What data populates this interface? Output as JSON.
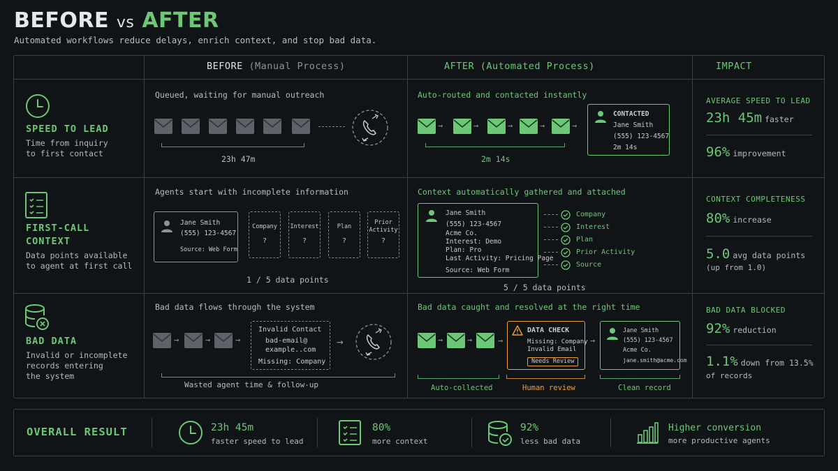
{
  "header": {
    "title_before": "BEFORE",
    "title_vs": "vs",
    "title_after": "AFTER",
    "subtitle": "Automated workflows reduce delays, enrich context, and stop bad data."
  },
  "columns": {
    "before": "BEFORE",
    "before_sub": "(Manual Process)",
    "after": "AFTER",
    "after_sub": "(Automated Process)",
    "impact": "IMPACT"
  },
  "rows": {
    "speed": {
      "title": "SPEED TO LEAD",
      "desc": "Time from inquiry\nto first contact",
      "before_caption": "Queued, waiting for manual outreach",
      "before_time": "23h 47m",
      "after_caption": "Auto-routed and contacted instantly",
      "after_time": "2m 14s",
      "card": {
        "status": "CONTACTED",
        "name": "Jane Smith",
        "phone": "(555) 123-4567",
        "time": "2m 14s"
      },
      "impact_label": "AVERAGE SPEED TO LEAD",
      "impact_1_value": "23h 45m",
      "impact_1_text": "faster",
      "impact_2_value": "96%",
      "impact_2_text": "improvement"
    },
    "context": {
      "title_1": "FIRST-CALL",
      "title_2": "CONTEXT",
      "desc": "Data points available\nto agent at first call",
      "before_caption": "Agents start with incomplete information",
      "before_card": {
        "name": "Jane Smith",
        "phone": "(555) 123-4567",
        "source": "Source: Web Form"
      },
      "missing": [
        {
          "label": "Company",
          "value": "?"
        },
        {
          "label": "Interest",
          "value": "?"
        },
        {
          "label": "Plan",
          "value": "?"
        },
        {
          "label": "Prior\nActivity",
          "value": "?"
        }
      ],
      "before_count": "1 / 5 data points",
      "after_caption": "Context automatically gathered and attached",
      "after_card": {
        "name": "Jane Smith",
        "phone": "(555) 123-4567",
        "company": "Acme Co.",
        "interest": "Interest: Demo",
        "plan": "Plan: Pro",
        "activity": "Last Activity: Pricing Page",
        "source": "Source: Web Form"
      },
      "checks": [
        "Company",
        "Interest",
        "Plan",
        "Prior Activity",
        "Source"
      ],
      "after_count": "5 / 5 data points",
      "impact_label": "CONTEXT COMPLETENESS",
      "impact_1_value": "80%",
      "impact_1_text": "increase",
      "impact_2_value": "5.0",
      "impact_2_text": "avg data points",
      "impact_2_sub": "(up from 1.0)"
    },
    "bad": {
      "title": "BAD DATA",
      "desc": "Invalid or incomplete\nrecords entering\nthe system",
      "before_caption": "Bad data flows through the system",
      "invalid": {
        "title": "Invalid Contact",
        "email_1": "bad-email@",
        "email_2": "example..com",
        "missing": "Missing: Company"
      },
      "before_footer": "Wasted agent time & follow-up",
      "after_caption": "Bad data caught and resolved at the right time",
      "check": {
        "title": "DATA CHECK",
        "line_1": "Missing: Company",
        "line_2": "Invalid Email",
        "badge": "Needs Review"
      },
      "clean": {
        "name": "Jane Smith",
        "phone": "(555) 123-4567",
        "company": "Acme Co.",
        "email": "jane.smith@acme.com"
      },
      "stage_1": "Auto-collected",
      "stage_2": "Human review",
      "stage_3": "Clean record",
      "impact_label": "BAD DATA BLOCKED",
      "impact_1_value": "92%",
      "impact_1_text": "reduction",
      "impact_2_value": "1.1%",
      "impact_2_text": "down from 13.5%",
      "impact_2_sub": "of records"
    }
  },
  "overall": {
    "label": "OVERALL RESULT",
    "items": [
      {
        "value": "23h 45m",
        "label": "faster speed to lead",
        "icon": "clock-icon"
      },
      {
        "value": "80%",
        "label": "more context",
        "icon": "checklist-icon"
      },
      {
        "value": "92%",
        "label": "less bad data",
        "icon": "database-check-icon"
      },
      {
        "value": "Higher conversion",
        "label": "more productive agents",
        "icon": "bar-chart-icon"
      }
    ]
  },
  "colors": {
    "accent": "#6cc877",
    "warning": "#f0a02e",
    "background": "#101417",
    "border": "#3a4044"
  }
}
